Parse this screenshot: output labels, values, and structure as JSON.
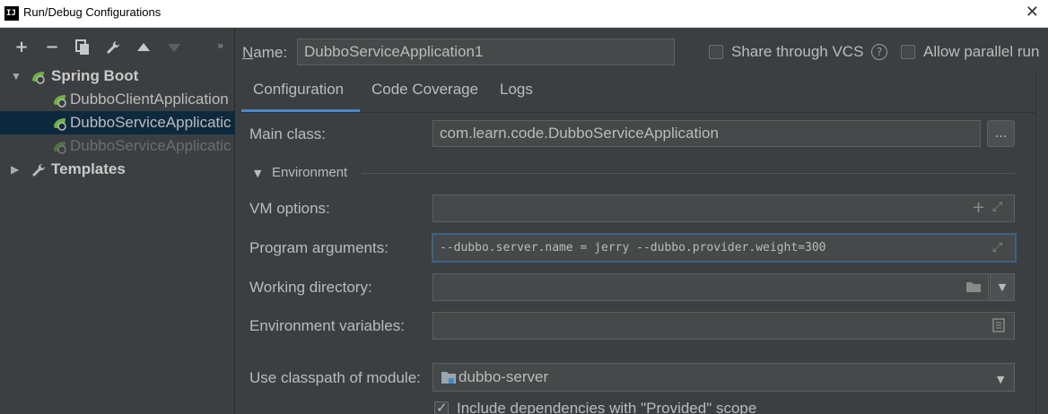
{
  "window": {
    "title": "Run/Debug Configurations",
    "app_icon_text": "IJ"
  },
  "toolbar": {
    "add": "+",
    "remove": "−",
    "more": "»"
  },
  "tree": {
    "spring_boot": "Spring Boot",
    "items": [
      {
        "label": "DubboClientApplication"
      },
      {
        "label": "DubboServiceApplicatic"
      },
      {
        "label": "DubboServiceApplicatic"
      }
    ],
    "templates": "Templates"
  },
  "header": {
    "name_label": "Name:",
    "name_value": "DubboServiceApplication1",
    "share_label": "Share through VCS",
    "parallel_label": "Allow parallel run"
  },
  "tabs": [
    {
      "label": "Configuration",
      "active": true
    },
    {
      "label": "Code Coverage",
      "active": false
    },
    {
      "label": "Logs",
      "active": false
    }
  ],
  "form": {
    "main_class_label": "Main class:",
    "main_class_value": "com.learn.code.DubboServiceApplication",
    "browse_label": "...",
    "environment_section": "Environment",
    "vm_options_label": "VM options:",
    "vm_options_value": "",
    "program_args_label": "Program arguments:",
    "program_args_value": "--dubbo.server.name = jerry --dubbo.provider.weight=300",
    "working_dir_label": "Working directory:",
    "working_dir_value": "",
    "env_vars_label": "Environment variables:",
    "env_vars_value": "",
    "classpath_label": "Use classpath of module:",
    "classpath_value": "dubbo-server",
    "include_deps_label": "Include dependencies with \"Provided\" scope",
    "include_deps_checked": true
  },
  "colors": {
    "accent": "#4a88c7",
    "selection": "#0d293e",
    "spring_green": "#6db33f"
  }
}
